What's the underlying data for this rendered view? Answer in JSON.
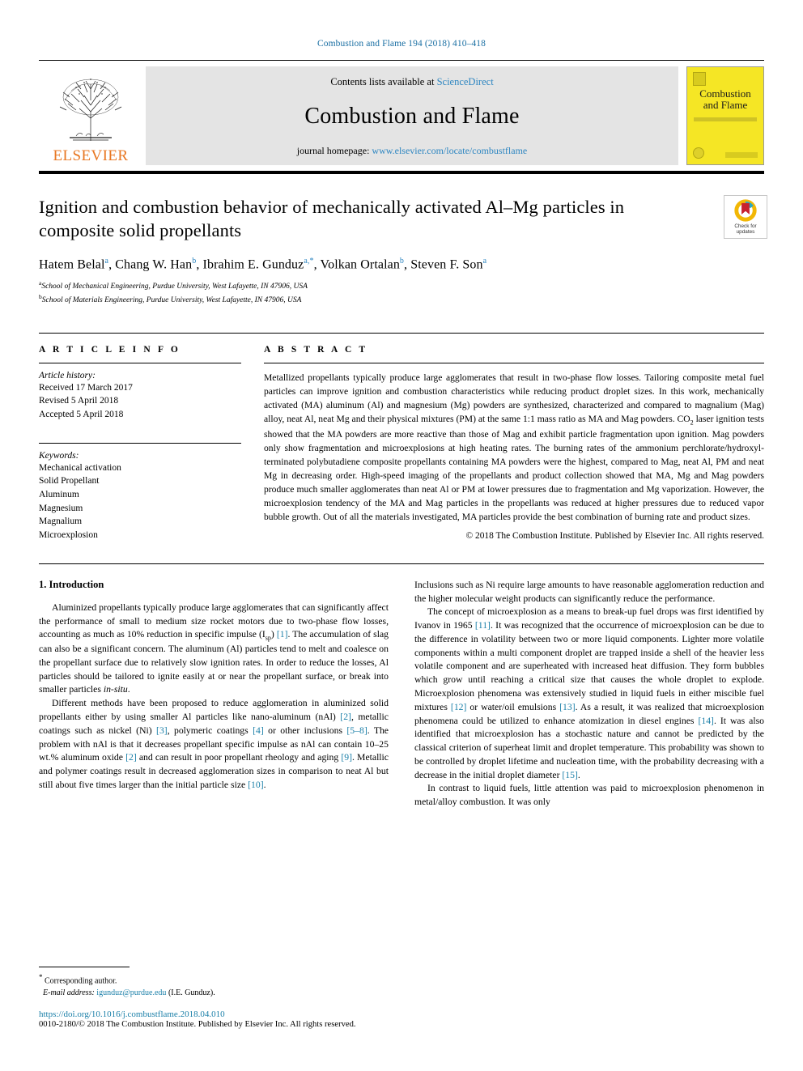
{
  "running_head": "Combustion and Flame 194 (2018) 410–418",
  "masthead": {
    "publisher": "ELSEVIER",
    "contents_prefix": "Contents lists available at ",
    "contents_link": "ScienceDirect",
    "journal_name": "Combustion and Flame",
    "homepage_prefix": "journal homepage: ",
    "homepage_link": "www.elsevier.com/locate/combustflame",
    "cover_title_line1": "Combustion",
    "cover_title_line2": "and Flame",
    "elsevier_logo_icon": "elsevier-tree-icon",
    "cover_thumb_icon": "journal-cover-icon"
  },
  "article": {
    "title": "Ignition and combustion behavior of mechanically activated Al–Mg particles in composite solid propellants",
    "authors_html": "Hatem Belal<sup>a</sup>, Chang W. Han<sup>b</sup>, Ibrahim E. Gunduz<sup>a,*</sup>, Volkan Ortalan<sup>b</sup>, Steven F. Son<sup>a</sup>",
    "affiliation_a": "School of Mechanical Engineering, Purdue University, West Lafayette, IN 47906, USA",
    "affiliation_b": "School of Materials Engineering, Purdue University, West Lafayette, IN 47906, USA",
    "crossmark_line1": "Check for",
    "crossmark_line2": "updates",
    "crossmark_icon": "crossmark-check-for-updates-icon"
  },
  "article_info": {
    "heading": "A R T I C L E   I N F O",
    "history_label": "Article history:",
    "history": [
      "Received 17 March 2017",
      "Revised 5 April 2018",
      "Accepted 5 April 2018"
    ],
    "keywords_label": "Keywords:",
    "keywords": [
      "Mechanical activation",
      "Solid Propellant",
      "Aluminum",
      "Magnesium",
      "Magnalium",
      "Microexplosion"
    ]
  },
  "abstract": {
    "heading": "A B S T R A C T",
    "text": "Metallized propellants typically produce large agglomerates that result in two-phase flow losses. Tailoring composite metal fuel particles can improve ignition and combustion characteristics while reducing product droplet sizes. In this work, mechanically activated (MA) aluminum (Al) and magnesium (Mg) powders are synthesized, characterized and compared to magnalium (Mag) alloy, neat Al, neat Mg and their physical mixtures (PM) at the same 1:1 mass ratio as MA and Mag powders. CO2 laser ignition tests showed that the MA powders are more reactive than those of Mag and exhibit particle fragmentation upon ignition. Mag powders only show fragmentation and microexplosions at high heating rates. The burning rates of the ammonium perchlorate/hydroxyl-terminated polybutadiene composite propellants containing MA powders were the highest, compared to Mag, neat Al, PM and neat Mg in decreasing order. High-speed imaging of the propellants and product collection showed that MA, Mg and Mag powders produce much smaller agglomerates than neat Al or PM at lower pressures due to fragmentation and Mg vaporization. However, the microexplosion tendency of the MA and Mag particles in the propellants was reduced at higher pressures due to reduced vapor bubble growth. Out of all the materials investigated, MA particles provide the best combination of burning rate and product sizes.",
    "copyright": "© 2018 The Combustion Institute. Published by Elsevier Inc. All rights reserved."
  },
  "body": {
    "section_heading": "1. Introduction",
    "left_paragraphs": [
      "Aluminized propellants typically produce large agglomerates that can significantly affect the performance of small to medium size rocket motors due to two-phase flow losses, accounting as much as 10% reduction in specific impulse (Isp) [1]. The accumulation of slag can also be a significant concern. The aluminum (Al) particles tend to melt and coalesce on the propellant surface due to relatively slow ignition rates. In order to reduce the losses, Al particles should be tailored to ignite easily at or near the propellant surface, or break into smaller particles in-situ.",
      "Different methods have been proposed to reduce agglomeration in aluminized solid propellants either by using smaller Al particles like nano-aluminum (nAl) [2], metallic coatings such as nickel (Ni) [3], polymeric coatings [4] or other inclusions [5–8]. The problem with nAl is that it decreases propellant specific impulse as nAl can contain 10–25 wt.% aluminum oxide [2] and can result in poor propellant rheology and aging [9]. Metallic and polymer coatings result in decreased agglomeration sizes in comparison to neat Al but still about five times larger than the initial particle size [10]."
    ],
    "right_paragraphs": [
      "Inclusions such as Ni require large amounts to have reasonable agglomeration reduction and the higher molecular weight products can significantly reduce the performance.",
      "The concept of microexplosion as a means to break-up fuel drops was first identified by Ivanov in 1965 [11]. It was recognized that the occurrence of microexplosion can be due to the difference in volatility between two or more liquid components. Lighter more volatile components within a multi component droplet are trapped inside a shell of the heavier less volatile component and are superheated with increased heat diffusion. They form bubbles which grow until reaching a critical size that causes the whole droplet to explode. Microexplosion phenomena was extensively studied in liquid fuels in either miscible fuel mixtures [12] or water/oil emulsions [13]. As a result, it was realized that microexplosion phenomena could be utilized to enhance atomization in diesel engines [14]. It was also identified that microexplosion has a stochastic nature and cannot be predicted by the classical criterion of superheat limit and droplet temperature. This probability was shown to be controlled by droplet lifetime and nucleation time, with the probability decreasing with a decrease in the initial droplet diameter [15].",
      "In contrast to liquid fuels, little attention was paid to microexplosion phenomenon in metal/alloy combustion. It was only"
    ]
  },
  "footer": {
    "corresponding_label": "Corresponding author.",
    "email_label": "E-mail address:",
    "email": "igunduz@purdue.edu",
    "email_suffix": "(I.E. Gunduz).",
    "doi": "https://doi.org/10.1016/j.combustflame.2018.04.010",
    "issn_line": "0010-2180/© 2018 The Combustion Institute. Published by Elsevier Inc. All rights reserved."
  },
  "colors": {
    "link": "#2e86c1",
    "ref": "#1a7fa8",
    "elsevier_orange": "#e87722",
    "cover_yellow": "#f5e625",
    "runhead": "#1a6fa3"
  }
}
